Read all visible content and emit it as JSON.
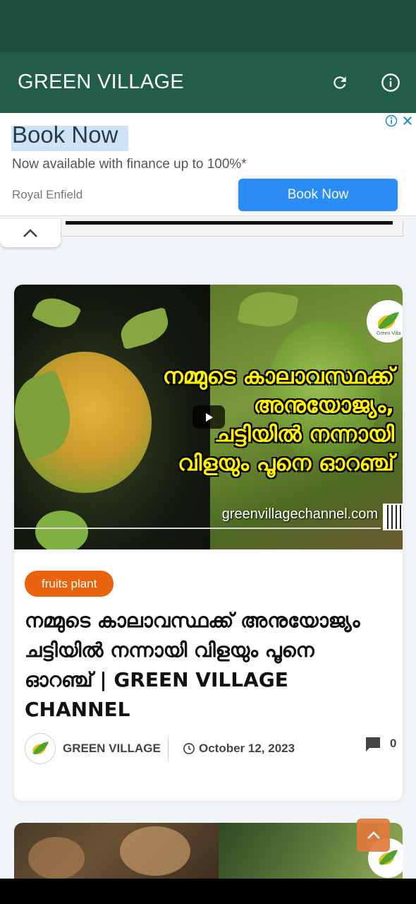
{
  "app_bar": {
    "title": "GREEN VILLAGE",
    "icons": [
      "refresh-icon",
      "info-icon"
    ]
  },
  "ad": {
    "title": "Book Now",
    "subtitle": "Now available with finance up to 100%*",
    "advertiser": "Royal Enfield",
    "cta_label": "Book Now",
    "icons": [
      "adchoices-icon",
      "close-icon"
    ],
    "cta_color": "#2a8cf5"
  },
  "post": {
    "thumbnail": {
      "headline_lines": [
        "നമ്മുടെ കാലാവസ്ഥക്ക്",
        "അനുയോജ്യം,",
        "ചട്ടിയിൽ നന്നായി",
        "വിളയും പൂനെ ഓറഞ്ച്"
      ],
      "url_text": "greenvillagechannel.com",
      "logo_text": "Green Villa"
    },
    "category": "fruits plant",
    "title": "നമ്മുടെ കാലാവസ്ഥക്ക് അനുയോജ്യം ചട്ടിയിൽ നന്നായി വിളയും പൂനെ ഓറഞ്ച് | GREEN VILLAGE CHANNEL",
    "author": "GREEN VILLAGE",
    "date": "October 12, 2023",
    "comment_count": "0"
  },
  "colors": {
    "app_bar": "#225c4a",
    "status_bar": "#1e4d3f",
    "category_badge": "#e8630c",
    "scroll_top": "#e07a3c"
  }
}
